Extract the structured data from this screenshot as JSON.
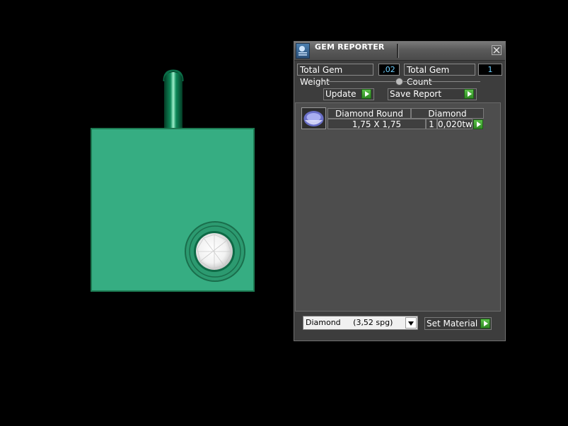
{
  "viewport": {
    "plate_color": "#36ad82",
    "bail_color": "#0f8a5c"
  },
  "panel": {
    "title": "GEM REPORTER",
    "total_weight_label": "Total Gem Weight",
    "total_weight_value": ",02",
    "total_count_label": "Total Gem Count",
    "total_count_value": "1",
    "update_label": "Update",
    "save_report_label": "Save Report",
    "gems": [
      {
        "shape": "Diamond Round",
        "material": "Diamond",
        "size": "1,75 X 1,75",
        "count": "1",
        "weight": "0,020tw"
      }
    ],
    "material_selected": "Diamond     (3,52 spg)",
    "set_material_label": "Set Material"
  }
}
